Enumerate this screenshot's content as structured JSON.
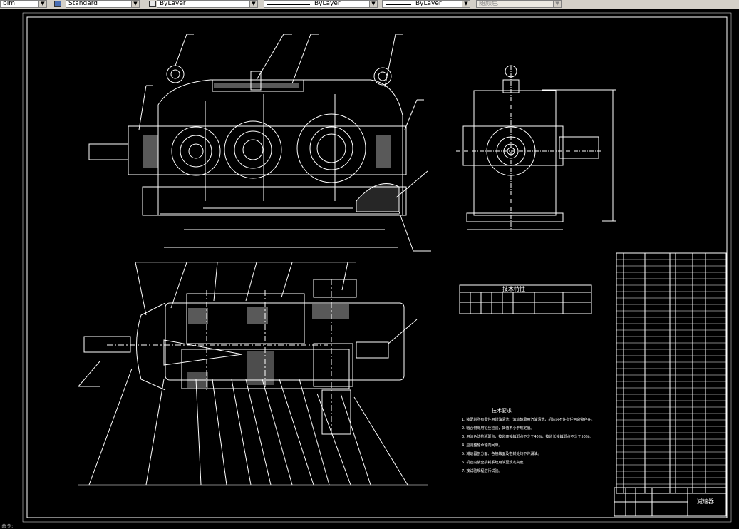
{
  "toolbar": {
    "dimstyle_value": "bim",
    "textstyle_value": "Standard",
    "layer_value": "ByLayer",
    "linetype_value": "ByLayer",
    "lineweight_value": "ByLayer",
    "color_value": "随颜色"
  },
  "drawing": {
    "tech_requirements_title": "技术要求",
    "tech_requirements": [
      "1. 装配前所有零件用煤油清洗，滚动轴承用汽油清洗，机体内不许有任何杂物存在。",
      "2. 啮合侧隙用铅丝检验，其值不小于规定值。",
      "3. 用涂色法检验斑点，按齿高接触斑点不少于40%，按齿长接触斑点不少于50%。",
      "4. 应调整轴承轴向间隙。",
      "5. 减速器剖分面、各接触面及密封处均不许漏油。",
      "6. 机座内装全损耗系统用油至规定高度。",
      "7. 按试验规程进行试验。"
    ],
    "spec_table_title": "技术特性",
    "title_block_name": "减速器",
    "statusbar_text": "命令:"
  }
}
